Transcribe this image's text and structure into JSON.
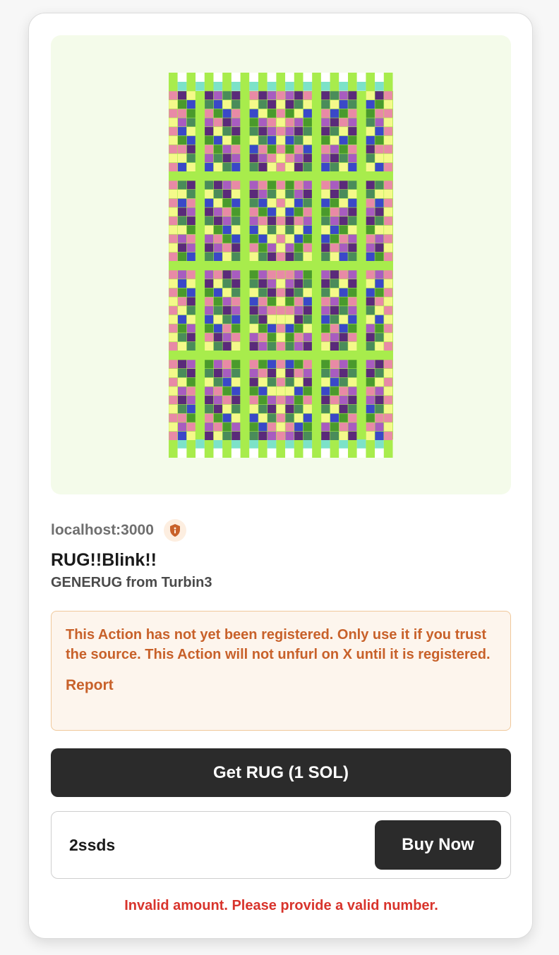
{
  "action": {
    "source": "localhost:3000",
    "title": "RUG!!Blink!!",
    "description": "GENERUG from Turbin3",
    "image_alt": "rug",
    "security_icon": "shield-info-icon"
  },
  "warning": {
    "text": "This Action has not yet been registered. Only use it if you trust the source. This Action will not unfurl on X until it is registered.",
    "report_label": "Report"
  },
  "buttons": {
    "primary_label": "Get RUG (1 SOL)",
    "buy_label": "Buy Now"
  },
  "amount": {
    "value": "2ssds"
  },
  "error_text": "Invalid amount. Please provide a valid number.",
  "colors": {
    "rug_base": "#a8ec4c",
    "fringe": "#7ce2c8",
    "palette": [
      "#4a9a2c",
      "#4a8c5a",
      "#e88aa6",
      "#f4f98a",
      "#a85cc0",
      "#3a48c8",
      "#5a2a7a",
      "#7ce2c8",
      "#a8ec4c",
      "#6cc83c"
    ]
  }
}
